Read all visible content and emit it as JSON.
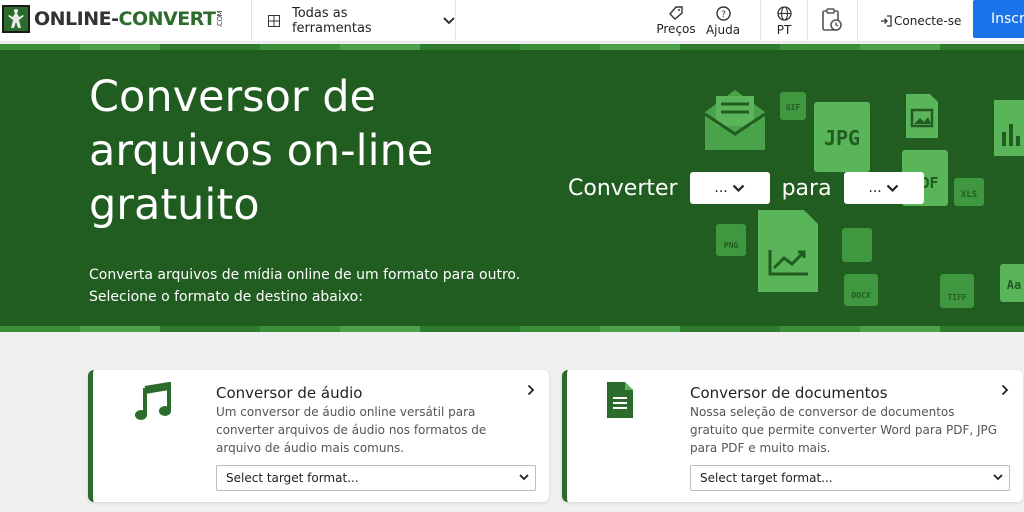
{
  "brand": {
    "logo_text_1": "ONLINE-",
    "logo_text_2": "CONVERT",
    "logo_suffix": ".COM"
  },
  "nav": {
    "tools_label": "Todas as ferramentas",
    "pricing_label": "Preços",
    "help_label": "Ajuda",
    "language_label": "PT",
    "login_label": "Conecte-se",
    "signup_label": "Inscr"
  },
  "hero": {
    "title": "Conversor de arquivos on-line gratuito",
    "subtitle_line1": "Converta arquivos de mídia online de um formato para outro.",
    "subtitle_line2": "Selecione o formato de destino abaixo:",
    "convert_label": "Converter",
    "to_label": "para",
    "from_value": "...",
    "to_value": "...",
    "file_badges": [
      "GIF",
      "JPG",
      "XLS",
      "PDF",
      "PNG",
      "DOCX",
      "TIFF",
      "Aa"
    ]
  },
  "cards": [
    {
      "title": "Conversor de áudio",
      "description": "Um conversor de áudio online versátil para converter arquivos de áudio nos formatos de arquivo de áudio mais comuns.",
      "select_placeholder": "Select target format..."
    },
    {
      "title": "Conversor de documentos",
      "description": "Nossa seleção de conversor de documentos gratuito que permite converter Word para PDF, JPG para PDF e muito mais.",
      "select_placeholder": "Select target format..."
    }
  ],
  "colors": {
    "brand_green": "#215c21",
    "accent_blue": "#1a73e8"
  }
}
